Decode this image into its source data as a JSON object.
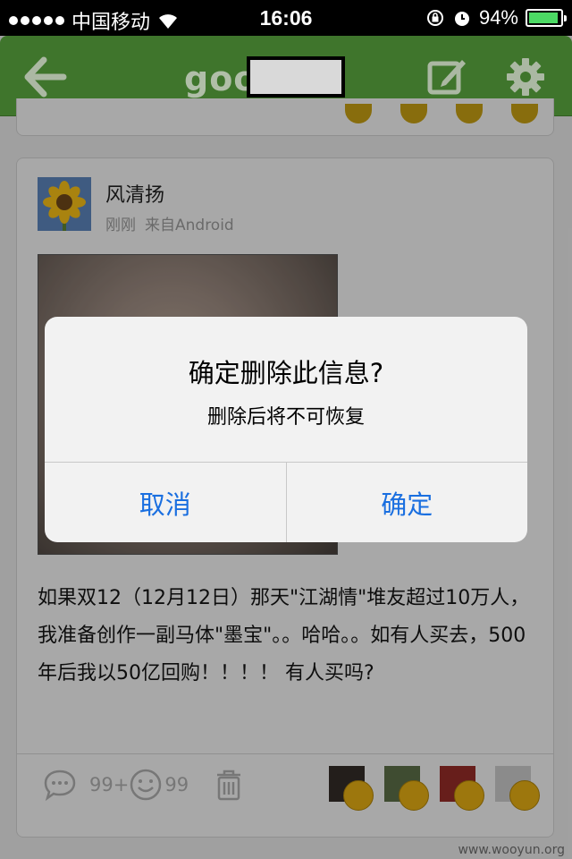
{
  "status_bar": {
    "carrier": "中国移动",
    "time": "16:06",
    "battery": "94%",
    "battery_level": 0.94,
    "icons": [
      "signal-dots-icon",
      "wifi-icon",
      "rotation-lock-icon",
      "alarm-icon",
      "battery-icon"
    ]
  },
  "navbar": {
    "title_prefix": "goo",
    "back_icon": "back-arrow-icon",
    "compose_icon": "compose-icon",
    "settings_icon": "gear-icon",
    "color": "#4a8a34"
  },
  "post": {
    "author": "风清扬",
    "time": "刚刚",
    "source": "来自Android",
    "text": "如果双12（12月12日）那天\"江湖情\"堆友超过10万人，我准备创作一副马体\"墨宝\"。。哈哈。。如有人买去，500年后我以50亿回购！！！！ 有人买吗?",
    "comment_count": "99+",
    "like_count": "99",
    "reactions": [
      "surprised-face-icon",
      "smile-face-icon",
      "heart-eyes-face-icon",
      "heart-eyes-face-icon"
    ]
  },
  "dialog": {
    "title": "确定删除此信息?",
    "message": "删除后将不可恢复",
    "cancel_label": "取消",
    "confirm_label": "确定",
    "button_color": "#1a6fe0"
  },
  "watermark": "www.wooyun.org"
}
